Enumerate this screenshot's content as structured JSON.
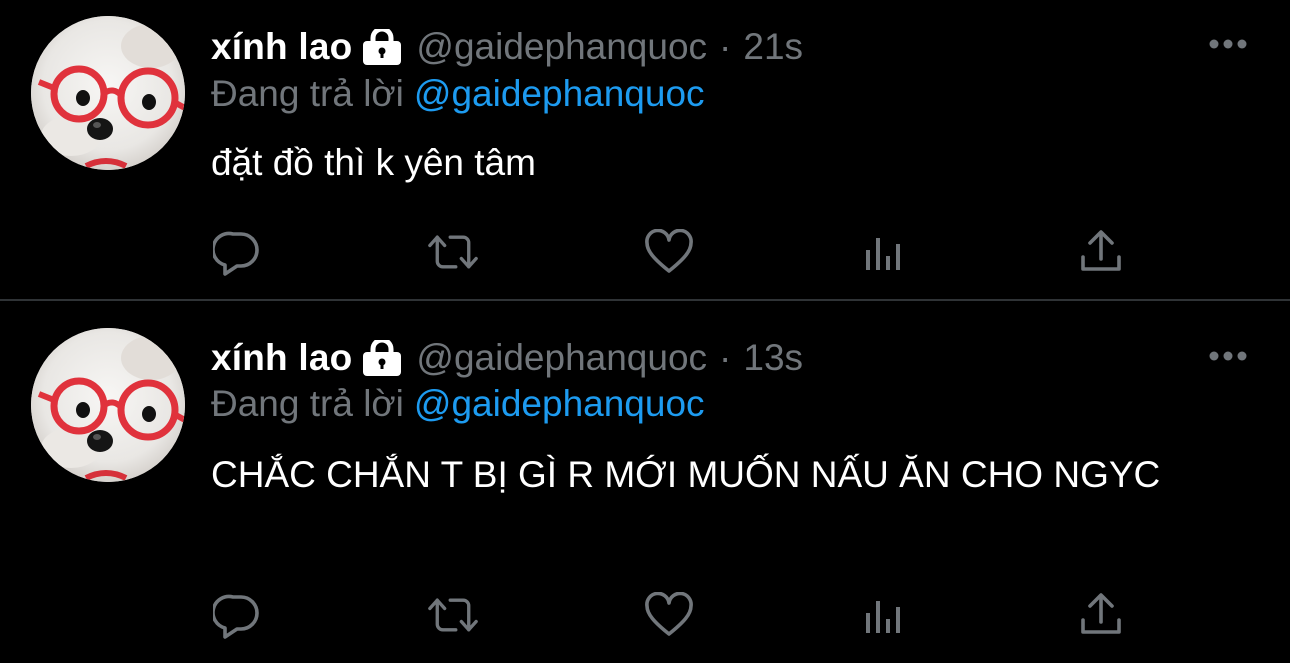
{
  "colors": {
    "background": "#000000",
    "primary_text": "#ffffff",
    "secondary_text": "#71767b",
    "accent": "#1d9bf0",
    "divider": "#2f3336"
  },
  "tweets": [
    {
      "display_name": "xính lao",
      "handle": "@gaidephanquoc",
      "separator": "·",
      "time": "21s",
      "replying_prefix": "Đang trả lời",
      "replying_to": "@gaidephanquoc",
      "text": "đặt đồ thì k yên tâm",
      "icons": {
        "lock": "lock-icon",
        "more": "more-icon",
        "reply": "reply-icon",
        "retweet": "retweet-icon",
        "like": "heart-icon",
        "views": "views-icon",
        "share": "share-icon"
      }
    },
    {
      "display_name": "xính lao",
      "handle": "@gaidephanquoc",
      "separator": "·",
      "time": "13s",
      "replying_prefix": "Đang trả lời",
      "replying_to": "@gaidephanquoc",
      "text": "CHẮC CHẮN T BỊ GÌ R MỚI MUỐN NẤU ĂN CHO NGYC",
      "icons": {
        "lock": "lock-icon",
        "more": "more-icon",
        "reply": "reply-icon",
        "retweet": "retweet-icon",
        "like": "heart-icon",
        "views": "views-icon",
        "share": "share-icon"
      }
    }
  ]
}
